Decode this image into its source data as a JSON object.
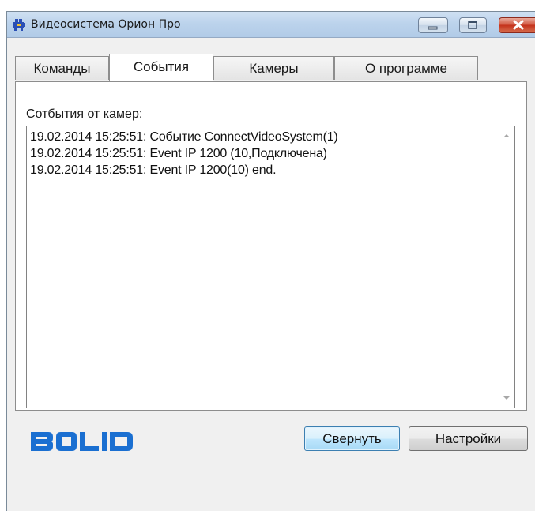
{
  "window": {
    "title": "Видеосистема Орион Про",
    "controls": [
      "minimize",
      "maximize",
      "close"
    ]
  },
  "tabs": [
    {
      "label": "Команды",
      "active": false
    },
    {
      "label": "События",
      "active": true
    },
    {
      "label": "Камеры",
      "active": false
    },
    {
      "label": "О программе",
      "active": false
    }
  ],
  "events_panel": {
    "label": "Сотбытия от камер:",
    "lines": [
      "19.02.2014 15:25:51: Событие ConnectVideoSystem(1)",
      "19.02.2014 15:25:51: Event IP 1200 (10,Подключена)",
      "19.02.2014 15:25:51: Event IP 1200(10) end."
    ]
  },
  "footer": {
    "logo_text": "BOLID",
    "minimize_button": "Свернуть",
    "settings_button": "Настройки"
  },
  "colors": {
    "logo_blue": "#1a6fd1",
    "default_button_border": "#3c7fb1",
    "close_button": "#c4321c"
  }
}
